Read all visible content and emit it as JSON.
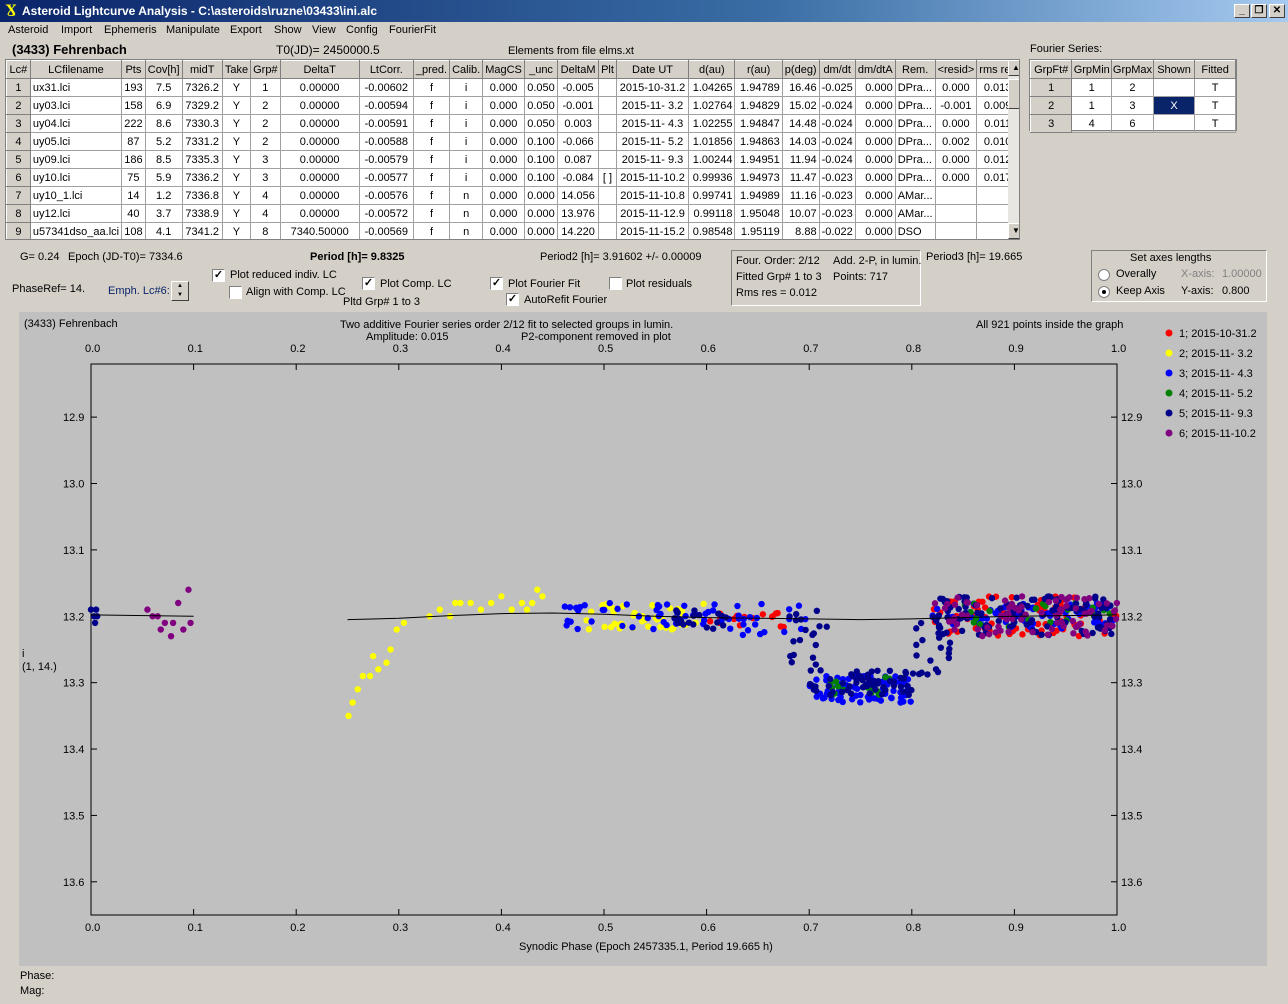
{
  "window": {
    "title": "Asteroid Lightcurve Analysis - C:\\asteroids\\ruzne\\03433\\ini.alc",
    "min": "_",
    "max": "тх",
    "close": "x"
  },
  "menu": [
    "Asteroid",
    "Import",
    "Ephemeris",
    "Manipulate",
    "Export",
    "Show",
    "View",
    "Config",
    "FourierFit"
  ],
  "header": {
    "asteroid": "(3433) Fehrenbach",
    "t0": "T0(JD)= 2450000.5",
    "elements": "Elements from file elms.xt",
    "fourier_series": "Fourier Series:"
  },
  "table": {
    "columns": [
      "Lc#",
      "LCfilename",
      "Pts",
      "Cov[h]",
      "midT",
      "Take",
      "Grp#",
      "DeltaT",
      "LtCorr.",
      "_pred.",
      "Calib.",
      "MagCS",
      "_unc",
      "DeltaM",
      "Plt",
      "Date UT",
      "d(au)",
      "r(au)",
      "p(deg)",
      "dm/dt",
      "dm/dtA",
      "Rem.",
      "<resid>",
      "rms res"
    ],
    "rows": [
      [
        "1",
        "ux31.lci",
        "193",
        "7.5",
        "7326.2",
        "Y",
        "1",
        "0.00000",
        "-0.00602",
        "f",
        "i",
        "0.000",
        "0.050",
        "-0.005",
        "",
        "2015-10-31.2",
        "1.04265",
        "1.94789",
        "16.46",
        "-0.025",
        "0.000",
        "DPra...",
        "0.000",
        "0.013"
      ],
      [
        "2",
        "uy03.lci",
        "158",
        "6.9",
        "7329.2",
        "Y",
        "2",
        "0.00000",
        "-0.00594",
        "f",
        "i",
        "0.000",
        "0.050",
        "-0.001",
        "",
        "2015-11- 3.2",
        "1.02764",
        "1.94829",
        "15.02",
        "-0.024",
        "0.000",
        "DPra...",
        "-0.001",
        "0.009"
      ],
      [
        "3",
        "uy04.lci",
        "222",
        "8.6",
        "7330.3",
        "Y",
        "2",
        "0.00000",
        "-0.00591",
        "f",
        "i",
        "0.000",
        "0.050",
        "0.003",
        "",
        "2015-11- 4.3",
        "1.02255",
        "1.94847",
        "14.48",
        "-0.024",
        "0.000",
        "DPra...",
        "0.000",
        "0.011"
      ],
      [
        "4",
        "uy05.lci",
        "87",
        "5.2",
        "7331.2",
        "Y",
        "2",
        "0.00000",
        "-0.00588",
        "f",
        "i",
        "0.000",
        "0.100",
        "-0.066",
        "",
        "2015-11- 5.2",
        "1.01856",
        "1.94863",
        "14.03",
        "-0.024",
        "0.000",
        "DPra...",
        "0.002",
        "0.010"
      ],
      [
        "5",
        "uy09.lci",
        "186",
        "8.5",
        "7335.3",
        "Y",
        "3",
        "0.00000",
        "-0.00579",
        "f",
        "i",
        "0.000",
        "0.100",
        "0.087",
        "",
        "2015-11- 9.3",
        "1.00244",
        "1.94951",
        "11.94",
        "-0.024",
        "0.000",
        "DPra...",
        "0.000",
        "0.012"
      ],
      [
        "6",
        "uy10.lci",
        "75",
        "5.9",
        "7336.2",
        "Y",
        "3",
        "0.00000",
        "-0.00577",
        "f",
        "i",
        "0.000",
        "0.100",
        "-0.084",
        "[ ]",
        "2015-11-10.2",
        "0.99936",
        "1.94973",
        "11.47",
        "-0.023",
        "0.000",
        "DPra...",
        "0.000",
        "0.017"
      ],
      [
        "7",
        "uy10_1.lci",
        "14",
        "1.2",
        "7336.8",
        "Y",
        "4",
        "0.00000",
        "-0.00576",
        "f",
        "n",
        "0.000",
        "0.000",
        "14.056",
        "",
        "2015-11-10.8",
        "0.99741",
        "1.94989",
        "11.16",
        "-0.023",
        "0.000",
        "AMar...",
        "",
        ""
      ],
      [
        "8",
        "uy12.lci",
        "40",
        "3.7",
        "7338.9",
        "Y",
        "4",
        "0.00000",
        "-0.00572",
        "f",
        "n",
        "0.000",
        "0.000",
        "13.976",
        "",
        "2015-11-12.9",
        "0.99118",
        "1.95048",
        "10.07",
        "-0.023",
        "0.000",
        "AMar...",
        "",
        ""
      ],
      [
        "9",
        "u57341dso_aa.lci",
        "108",
        "4.1",
        "7341.2",
        "Y",
        "8",
        "7340.50000",
        "-0.00569",
        "f",
        "n",
        "0.000",
        "0.000",
        "14.220",
        "",
        "2015-11-15.2",
        "0.98548",
        "1.95119",
        "8.88",
        "-0.022",
        "0.000",
        "DSO",
        "",
        ""
      ]
    ]
  },
  "fourier_table": {
    "columns": [
      "GrpFt#",
      "GrpMin",
      "GrpMax",
      "Shown",
      "Fitted"
    ],
    "rows": [
      [
        "1",
        "1",
        "2",
        "",
        "T"
      ],
      [
        "2",
        "1",
        "3",
        "X",
        "T"
      ],
      [
        "3",
        "4",
        "6",
        "",
        "T"
      ]
    ]
  },
  "controls": {
    "g": "G= 0.24",
    "epoch": "Epoch (JD-T0)= 7334.6",
    "period": "Period [h]= 9.8325",
    "period2": "Period2 [h]= 3.91602 +/- 0.00009",
    "period3": "Period3 [h]= 19.665",
    "phaseref": "PhaseRef= 14.",
    "emph": "Emph. Lc#6:",
    "plot_reduced": "Plot reduced indiv. LC",
    "align": "Align with Comp. LC",
    "plot_comp": "Plot Comp. LC",
    "pltd_grp": "Pltd Grp#  1   to   3",
    "plot_fourier": "Plot Fourier Fit",
    "autorefit": "AutoRefit Fourier",
    "plot_resid": "Plot residuals",
    "four_order": "Four. Order:  2/12",
    "add2p": "Add. 2-P, in lumin.",
    "fitted_grp": "Fitted Grp# 1 to 3",
    "points": "Points: 717",
    "rms": "Rms res     = 0.012",
    "axes_title": "Set axes lengths",
    "overally": "Overally",
    "keep_axis": "Keep Axis",
    "xaxis_lbl": "X-axis:",
    "xaxis_val": "1.00000",
    "yaxis_lbl": "Y-axis:",
    "yaxis_val": "0.800"
  },
  "plot": {
    "name": "(3433) Fehrenbach",
    "subtitle1": "Two additive Fourier series order 2/12 fit to selected groups in lumin.",
    "subtitle2": "Amplitude: 0.015",
    "subtitle3": "P2-component removed in plot",
    "inside": "All 921 points inside the graph",
    "ylabel1": "i",
    "ylabel2": "(1, 14.)"
  },
  "status": {
    "phase": "Phase:",
    "mag": "Mag:"
  },
  "chart_data": {
    "type": "scatter",
    "title": "Two additive Fourier series order 2/12 fit to selected groups in lumin.",
    "xlabel": "Synodic Phase (Epoch 2457335.1, Period 19.665 h)",
    "ylabel": "i",
    "xlim": [
      0,
      1
    ],
    "ylim": [
      13.65,
      12.82
    ],
    "xticks": [
      0,
      0.1,
      0.2,
      0.3,
      0.4,
      0.5,
      0.6,
      0.7,
      0.8,
      0.9,
      1.0
    ],
    "xtick_labels": [
      "0.0",
      "0.1",
      "0.2",
      "0.3",
      "0.4",
      "0.5",
      "0.6",
      "0.7",
      "0.8",
      "0.9",
      "1.0"
    ],
    "yticks": [
      12.9,
      13.0,
      13.1,
      13.2,
      13.3,
      13.4,
      13.5,
      13.6
    ],
    "ytick_labels": [
      "12.9",
      "13.0",
      "13.1",
      "13.2",
      "13.3",
      "13.4",
      "13.5",
      "13.6"
    ],
    "legend_position": "right",
    "series": [
      {
        "name": "1; 2015-10-31.2",
        "color": "#ff0000",
        "ranges": [
          [
            0.6,
            0.62,
            13.19,
            13.21,
            5
          ],
          [
            0.62,
            0.68,
            13.19,
            13.22,
            12
          ],
          [
            0.82,
            1.0,
            13.17,
            13.23,
            90
          ]
        ]
      },
      {
        "name": "2; 2015-11- 3.2",
        "color": "#ffff00",
        "points": [
          [
            0.251,
            13.35
          ],
          [
            0.255,
            13.33
          ],
          [
            0.26,
            13.31
          ],
          [
            0.265,
            13.29
          ],
          [
            0.272,
            13.29
          ],
          [
            0.275,
            13.26
          ],
          [
            0.28,
            13.28
          ],
          [
            0.288,
            13.27
          ],
          [
            0.292,
            13.25
          ],
          [
            0.298,
            13.22
          ],
          [
            0.305,
            13.21
          ],
          [
            0.33,
            13.2
          ],
          [
            0.34,
            13.19
          ],
          [
            0.35,
            13.2
          ],
          [
            0.355,
            13.18
          ],
          [
            0.36,
            13.18
          ],
          [
            0.37,
            13.18
          ],
          [
            0.38,
            13.19
          ],
          [
            0.39,
            13.18
          ],
          [
            0.4,
            13.17
          ],
          [
            0.41,
            13.19
          ],
          [
            0.42,
            13.18
          ],
          [
            0.425,
            13.19
          ],
          [
            0.43,
            13.18
          ],
          [
            0.435,
            13.16
          ],
          [
            0.44,
            13.17
          ]
        ],
        "ranges": [
          [
            0.48,
            0.6,
            13.18,
            13.22,
            45
          ]
        ]
      },
      {
        "name": "3; 2015-11- 4.3",
        "color": "#0000ff",
        "ranges": [
          [
            0.46,
            0.6,
            13.18,
            13.22,
            40
          ],
          [
            0.6,
            0.7,
            13.18,
            13.23,
            25
          ],
          [
            0.7,
            0.8,
            13.29,
            13.33,
            80
          ],
          [
            0.82,
            1.0,
            13.18,
            13.22,
            70
          ]
        ]
      },
      {
        "name": "4; 2015-11- 5.2",
        "color": "#008000",
        "ranges": [
          [
            0.72,
            0.8,
            13.29,
            13.32,
            15
          ],
          [
            0.85,
            1.0,
            13.18,
            13.22,
            25
          ]
        ]
      },
      {
        "name": "5; 2015-11- 9.3",
        "color": "#00008b",
        "points": [
          [
            0.0,
            13.19
          ],
          [
            0.005,
            13.19
          ],
          [
            0.003,
            13.2
          ],
          [
            0.006,
            13.2
          ],
          [
            0.004,
            13.21
          ]
        ],
        "ranges": [
          [
            0.56,
            0.62,
            13.19,
            13.22,
            20
          ],
          [
            0.68,
            0.72,
            13.19,
            13.28,
            18
          ],
          [
            0.7,
            0.8,
            13.28,
            13.32,
            60
          ],
          [
            0.8,
            0.84,
            13.21,
            13.3,
            18
          ],
          [
            0.82,
            1.0,
            13.17,
            13.23,
            110
          ]
        ]
      },
      {
        "name": "6; 2015-11-10.2",
        "color": "#800080",
        "points": [
          [
            0.055,
            13.19
          ],
          [
            0.06,
            13.2
          ],
          [
            0.065,
            13.2
          ],
          [
            0.068,
            13.22
          ],
          [
            0.072,
            13.21
          ],
          [
            0.078,
            13.23
          ],
          [
            0.08,
            13.21
          ],
          [
            0.085,
            13.18
          ],
          [
            0.09,
            13.22
          ],
          [
            0.095,
            13.16
          ],
          [
            0.097,
            13.21
          ]
        ],
        "ranges": [
          [
            0.82,
            1.0,
            13.17,
            13.23,
            80
          ]
        ]
      }
    ],
    "fit_curve": {
      "x": [
        0.0,
        0.1,
        0.25,
        0.3,
        0.35,
        0.4,
        0.45,
        0.5,
        0.55,
        0.6,
        0.65,
        0.7,
        0.75,
        0.8,
        0.85,
        0.9,
        0.95,
        1.0
      ],
      "y": [
        13.198,
        13.2,
        13.205,
        13.203,
        13.199,
        13.196,
        13.195,
        13.197,
        13.2,
        13.202,
        13.203,
        13.204,
        13.205,
        13.204,
        13.202,
        13.2,
        13.199,
        13.198
      ]
    }
  }
}
